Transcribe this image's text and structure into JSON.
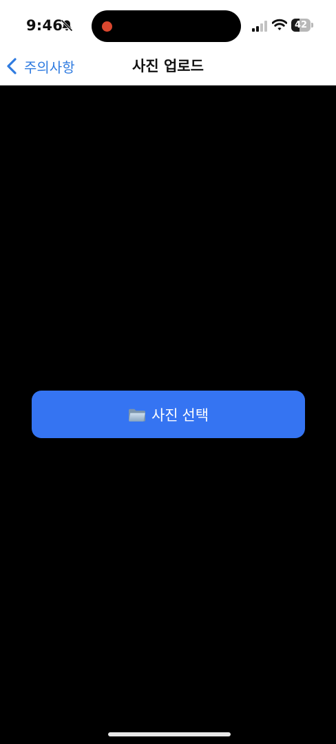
{
  "status_bar": {
    "time": "9:46",
    "battery_level": "42",
    "battery_fraction": 0.42,
    "icons": [
      "bell-slash-icon",
      "recording-dot",
      "cellular-signal-icon",
      "wifi-icon",
      "battery-icon"
    ]
  },
  "nav": {
    "back_label": "주의사항",
    "title": "사진 업로드",
    "back_icon": "chevron-left-icon"
  },
  "main": {
    "select_button_label": "사진 선택",
    "select_button_icon": "folder-icon"
  },
  "colors": {
    "accent": "#2f7be0",
    "button": "#3574f2",
    "background": "#000000",
    "header": "#ffffff",
    "recording": "#d9472f"
  }
}
